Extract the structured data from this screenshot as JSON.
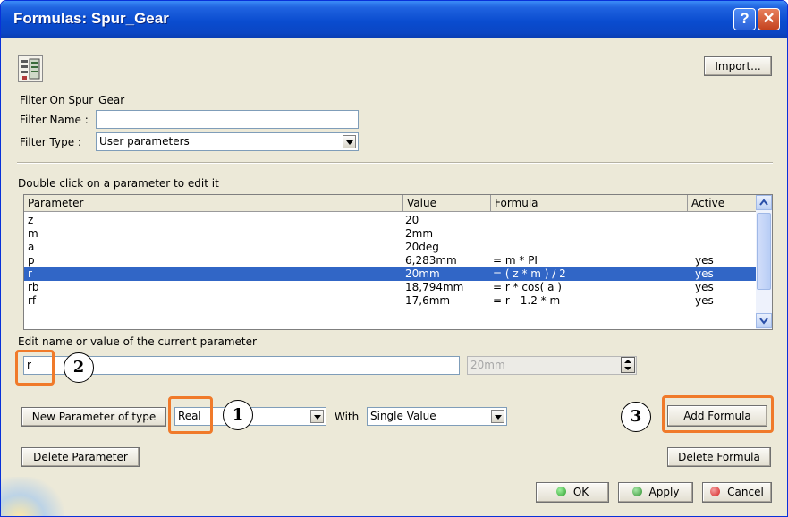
{
  "window": {
    "title": "Formulas: Spur_Gear",
    "help_glyph": "?",
    "close_glyph": "✕"
  },
  "toolbar": {
    "import_label": "Import..."
  },
  "filter": {
    "section_title": "Filter On Spur_Gear",
    "name_label": "Filter Name :",
    "name_value": "",
    "type_label": "Filter Type :",
    "type_value": "User parameters"
  },
  "table": {
    "hint": "Double click on a parameter to edit it",
    "columns": [
      "Parameter",
      "Value",
      "Formula",
      "Active"
    ],
    "rows": [
      {
        "param": "z",
        "value": "20",
        "formula": "",
        "active": ""
      },
      {
        "param": "m",
        "value": "2mm",
        "formula": "",
        "active": ""
      },
      {
        "param": "a",
        "value": "20deg",
        "formula": "",
        "active": ""
      },
      {
        "param": "p",
        "value": "6,283mm",
        "formula": "= m * PI",
        "active": "yes"
      },
      {
        "param": "r",
        "value": "20mm",
        "formula": "= ( z * m ) / 2",
        "active": "yes",
        "selected": true
      },
      {
        "param": "rb",
        "value": "18,794mm",
        "formula": "= r * cos( a )",
        "active": "yes"
      },
      {
        "param": "rf",
        "value": "17,6mm",
        "formula": "= r - 1.2 * m",
        "active": "yes"
      }
    ]
  },
  "edit": {
    "label": "Edit name or value of the current parameter",
    "name_value": "r",
    "value_value": "20mm"
  },
  "new_param": {
    "button_label": "New Parameter of type",
    "type_value": "Real",
    "with_label": "With",
    "with_value": "Single Value"
  },
  "buttons": {
    "add_formula": "Add Formula",
    "delete_parameter": "Delete Parameter",
    "delete_formula": "Delete Formula",
    "ok": "OK",
    "apply": "Apply",
    "cancel": "Cancel"
  },
  "callouts": {
    "one": "1",
    "two": "2",
    "three": "3"
  },
  "colors": {
    "callout_border": "#f07a2a",
    "selection": "#3166c6",
    "ok_dot": "#2ea02e",
    "apply_dot": "#2f8f2f",
    "cancel_dot": "#d62222"
  }
}
